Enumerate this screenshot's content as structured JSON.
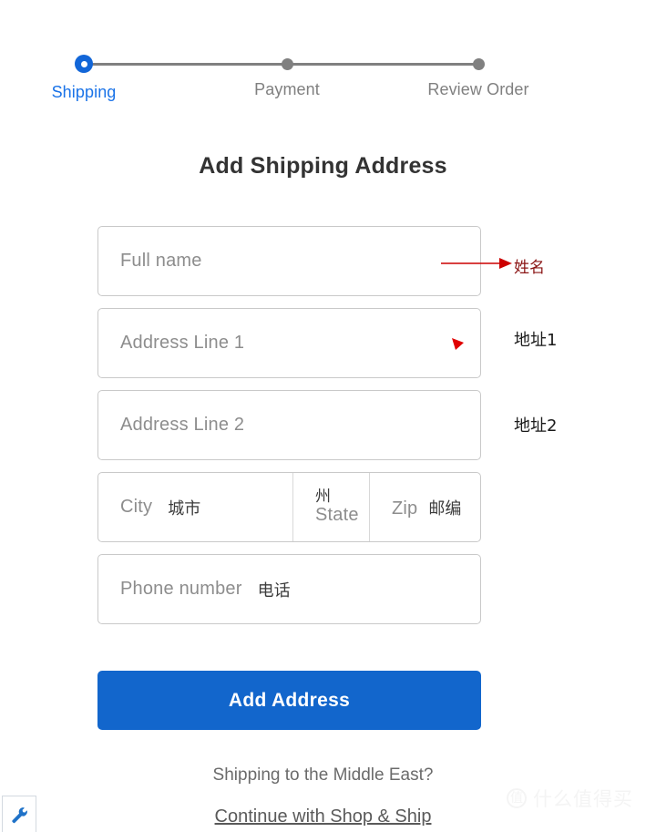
{
  "stepper": {
    "steps": [
      {
        "label": "Shipping",
        "state": "active"
      },
      {
        "label": "Payment",
        "state": "inactive"
      },
      {
        "label": "Review Order",
        "state": "inactive"
      }
    ],
    "active_color": "#1a73e8",
    "inactive_color": "#808080"
  },
  "heading": {
    "title": "Add Shipping Address"
  },
  "form": {
    "full_name": {
      "placeholder": "Full name",
      "value": ""
    },
    "address_line_1": {
      "placeholder": "Address Line 1",
      "value": ""
    },
    "address_line_2": {
      "placeholder": "Address Line 2",
      "value": ""
    },
    "city": {
      "placeholder": "City",
      "translation": "城市",
      "value": ""
    },
    "state": {
      "placeholder": "State",
      "translation": "州",
      "value": ""
    },
    "zip": {
      "placeholder": "Zip",
      "translation": "邮编",
      "value": ""
    },
    "phone": {
      "placeholder": "Phone number",
      "translation": "电话",
      "value": ""
    }
  },
  "submit": {
    "label": "Add Address",
    "color": "#1266cc"
  },
  "footer": {
    "note": "Shipping to the Middle East?",
    "link_label": "Continue with Shop & Ship"
  },
  "annotations": {
    "color": "#cc0000",
    "full_name_label": "姓名",
    "address_1_label": "地址1",
    "address_2_label": "地址2"
  },
  "chrome": {
    "tool_icon": "wrench-icon"
  },
  "watermark": {
    "mark": "值",
    "text": "什么值得买"
  }
}
